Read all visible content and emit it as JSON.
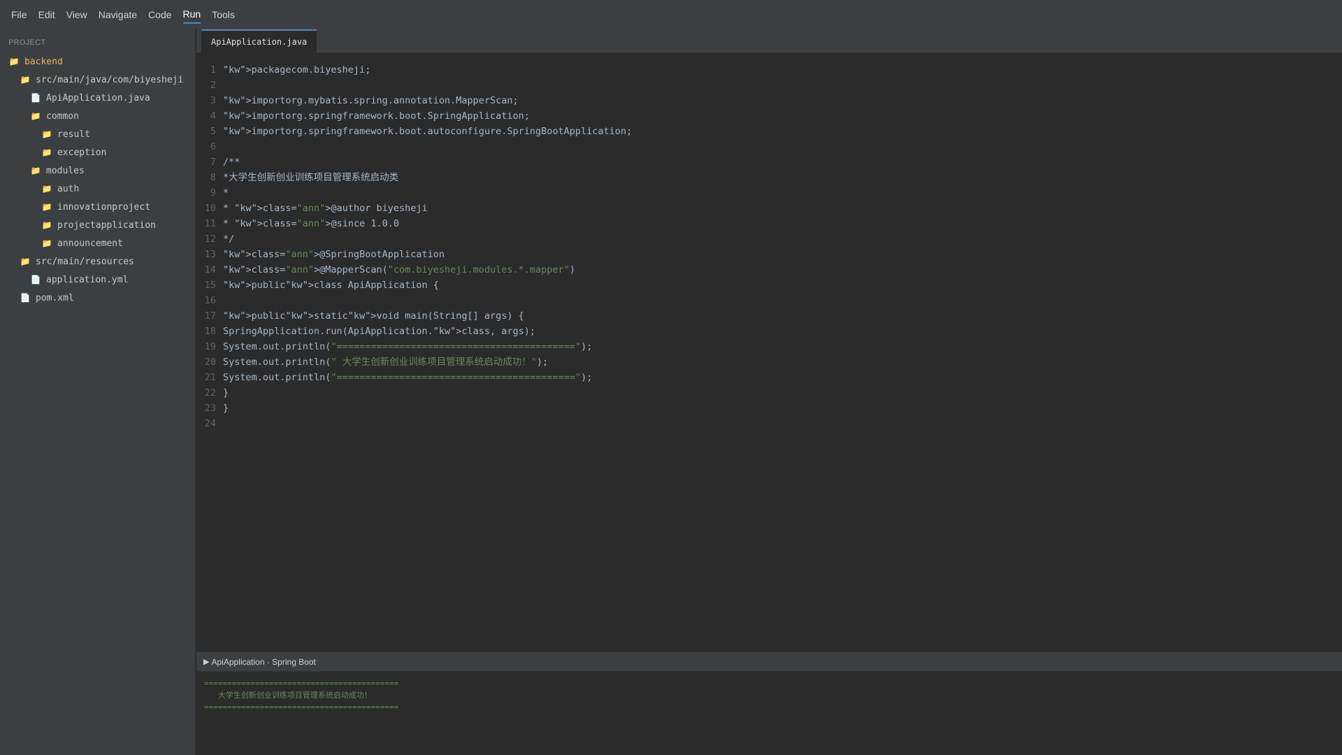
{
  "menu": {
    "items": [
      "File",
      "Edit",
      "View",
      "Navigate",
      "Code",
      "Run",
      "Tools"
    ],
    "active": "Run"
  },
  "sidebar": {
    "title": "PROJECT",
    "tree": [
      {
        "label": "backend",
        "type": "folder",
        "level": 0
      },
      {
        "label": "src/main/java/com/biyesheji",
        "type": "folder",
        "level": 1
      },
      {
        "label": "ApiApplication.java",
        "type": "file",
        "level": 2
      },
      {
        "label": "common",
        "type": "folder",
        "level": 2
      },
      {
        "label": "result",
        "type": "folder",
        "level": 3
      },
      {
        "label": "exception",
        "type": "folder",
        "level": 3
      },
      {
        "label": "modules",
        "type": "folder",
        "level": 2
      },
      {
        "label": "auth",
        "type": "folder",
        "level": 3
      },
      {
        "label": "innovationproject",
        "type": "folder",
        "level": 3
      },
      {
        "label": "projectapplication",
        "type": "folder",
        "level": 3
      },
      {
        "label": "announcement",
        "type": "folder",
        "level": 3
      },
      {
        "label": "src/main/resources",
        "type": "folder",
        "level": 1
      },
      {
        "label": "application.yml",
        "type": "file",
        "level": 2
      },
      {
        "label": "pom.xml",
        "type": "file",
        "level": 1
      }
    ]
  },
  "editor": {
    "tab_label": "ApiApplication.java",
    "lines": [
      [
        {
          "t": "\"kw\">packagecom.biyesheji;"
        }
      ],
      [],
      [
        {
          "t": "\"kw\">importorg.mybatis.spring.annotation.MapperScan;"
        }
      ],
      [
        {
          "t": "\"kw\">importorg.springframework.boot.SpringApplication;"
        }
      ],
      [
        {
          "t": "\"kw\">importorg.springframework.boot.autoconfigure.SpringBootApplication;"
        }
      ],
      [],
      [
        {
          "t": "/**"
        }
      ],
      [
        {
          "t": "*大学生创新创业训练项目管理系统启动类"
        }
      ],
      [
        {
          "t": "*"
        }
      ],
      [
        {
          "t": "* \"kw\">class="
        },
        {
          "t": "\"ann\"",
          "s": 1
        },
        {
          "t": ">@author biyesheji"
        }
      ],
      [
        {
          "t": "* \"kw\">class="
        },
        {
          "t": "\"ann\"",
          "s": 1
        },
        {
          "t": ">@since 1.0.0"
        }
      ],
      [
        {
          "t": "*/"
        }
      ],
      [
        {
          "t": "\"kw\">class="
        },
        {
          "t": "\"ann\"",
          "s": 1
        },
        {
          "t": ">@SpringBootApplication"
        }
      ],
      [
        {
          "t": "\"kw\">class="
        },
        {
          "t": "\"ann\"",
          "s": 1
        },
        {
          "t": ">@MapperScan("
        },
        {
          "t": "\"com.biyesheji.modules.*.mapper\"",
          "s": 1
        },
        {
          "t": ")"
        }
      ],
      [
        {
          "t": "\"kw\">public\"kw\">class ApiApplication {"
        }
      ],
      [],
      [
        {
          "t": "\"kw\">public\"kw\">static\"kw\">void main(String[] args) {"
        }
      ],
      [
        {
          "t": "SpringApplication.run(ApiApplication.\"kw\">class, args);"
        }
      ],
      [
        {
          "t": "System.out.println("
        },
        {
          "t": "\"==========================================\"",
          "s": 1
        },
        {
          "t": ");"
        }
      ],
      [
        {
          "t": "System.out.println("
        },
        {
          "t": "\" 大学生创新创业训练项目管理系统启动成功！\"",
          "s": 1
        },
        {
          "t": ");"
        }
      ],
      [
        {
          "t": "System.out.println("
        },
        {
          "t": "\"==========================================\"",
          "s": 1
        },
        {
          "t": ");"
        }
      ],
      [
        {
          "t": "}"
        }
      ],
      [
        {
          "t": "}"
        }
      ],
      []
    ]
  },
  "run_panel": {
    "title": "ApiApplication · Spring Boot",
    "output": [
      "==========================================",
      "   大学生创新创业训练项目管理系统启动成功！",
      "=========================================="
    ]
  },
  "colors": {
    "background": "#2b2b2b",
    "panel": "#3c3f41",
    "accent": "#4a88c7",
    "string": "#6a8759",
    "code": "#a9b7c6",
    "folder": "#d6a650"
  },
  "icons": {
    "folder": "folder-icon",
    "file": "file-icon",
    "run": "play-icon"
  }
}
